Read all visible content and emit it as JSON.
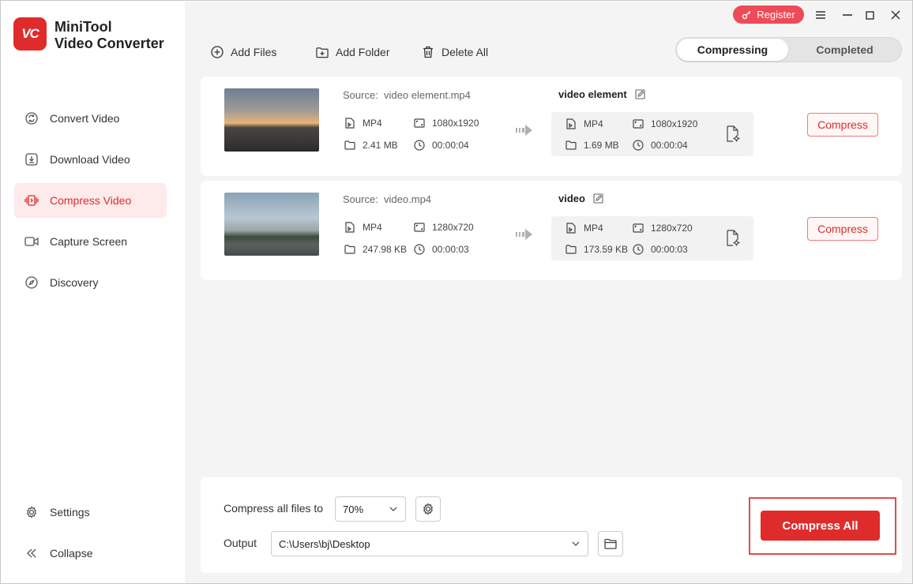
{
  "app": {
    "logo_text": "VC",
    "title_line1": "MiniTool",
    "title_line2": "Video Converter",
    "brand_color": "#e02b2b"
  },
  "sidebar": {
    "items": [
      {
        "label": "Convert Video",
        "icon": "convert-icon",
        "active": false
      },
      {
        "label": "Download Video",
        "icon": "download-icon",
        "active": false
      },
      {
        "label": "Compress Video",
        "icon": "compress-icon",
        "active": true
      },
      {
        "label": "Capture Screen",
        "icon": "camera-icon",
        "active": false
      },
      {
        "label": "Discovery",
        "icon": "compass-icon",
        "active": false
      }
    ],
    "settings_label": "Settings",
    "collapse_label": "Collapse"
  },
  "titlebar": {
    "register_label": "Register"
  },
  "toolbar": {
    "add_files": "Add Files",
    "add_folder": "Add Folder",
    "delete_all": "Delete All"
  },
  "tabs": {
    "compressing": "Compressing",
    "completed": "Completed"
  },
  "files": [
    {
      "source_label": "Source:",
      "source_name": "video element.mp4",
      "src_format": "MP4",
      "src_resolution": "1080x1920",
      "src_size": "2.41 MB",
      "src_duration": "00:00:04",
      "target_name": "video element",
      "tgt_format": "MP4",
      "tgt_resolution": "1080x1920",
      "tgt_size": "1.69 MB",
      "tgt_duration": "00:00:04",
      "button": "Compress"
    },
    {
      "source_label": "Source:",
      "source_name": "video.mp4",
      "src_format": "MP4",
      "src_resolution": "1280x720",
      "src_size": "247.98 KB",
      "src_duration": "00:00:03",
      "target_name": "video",
      "tgt_format": "MP4",
      "tgt_resolution": "1280x720",
      "tgt_size": "173.59 KB",
      "tgt_duration": "00:00:03",
      "button": "Compress"
    }
  ],
  "bottom": {
    "compress_label": "Compress all files to",
    "compress_value": "70%",
    "output_label": "Output",
    "output_path": "C:\\Users\\bj\\Desktop",
    "compress_all": "Compress All"
  }
}
